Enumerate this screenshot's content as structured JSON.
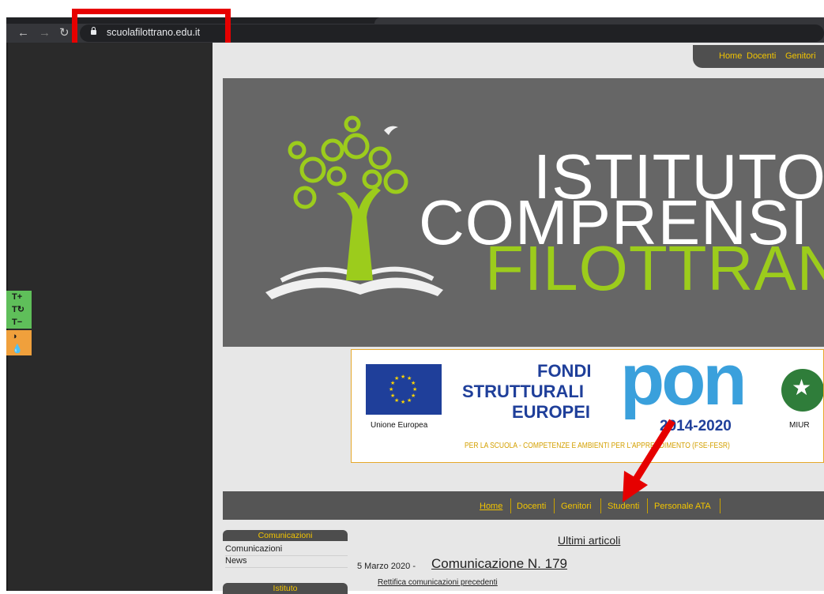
{
  "browser": {
    "url": "scuolafilottrano.edu.it",
    "back_icon": "arrow-left-icon",
    "forward_icon": "arrow-right-icon",
    "reload_icon": "reload-icon",
    "lock_icon": "lock-icon"
  },
  "accessibility_toolbar": {
    "buttons": [
      "T+",
      "T↻",
      "T−",
      "◑",
      "💧"
    ]
  },
  "top_nav": {
    "items": [
      "Home",
      "Docenti",
      "Genitori"
    ]
  },
  "banner": {
    "title_lines": [
      "ISTITUTO",
      "COMPRENSI",
      "FILOTTRAN"
    ]
  },
  "pon": {
    "eu_label": "Unione Europea",
    "fondi_lines": [
      "FONDI",
      "STRUTTURALI",
      "EUROPEI"
    ],
    "pon_word": "pon",
    "years": "2014-2020",
    "miur": "MIUR",
    "footer": "PER LA SCUOLA - COMPETENZE E AMBIENTI PER L'APPRENDIMENTO (FSE-FESR)"
  },
  "main_nav": {
    "items": [
      "Home",
      "Docenti",
      "Genitori",
      "Studenti",
      "Personale ATA"
    ]
  },
  "sidebar": {
    "box1_title": "Comunicazioni",
    "box1_links": [
      "Comunicazioni",
      "News"
    ],
    "box2_title": "Istituto"
  },
  "articles": {
    "heading": "Ultimi articoli",
    "date": "5 Marzo 2020 -",
    "title": "Comunicazione N. 179",
    "sub": "Rettifica comunicazioni precedenti"
  },
  "colors": {
    "accent": "#f2c400",
    "highlight": "#e60000",
    "green": "#9ccc1c"
  }
}
